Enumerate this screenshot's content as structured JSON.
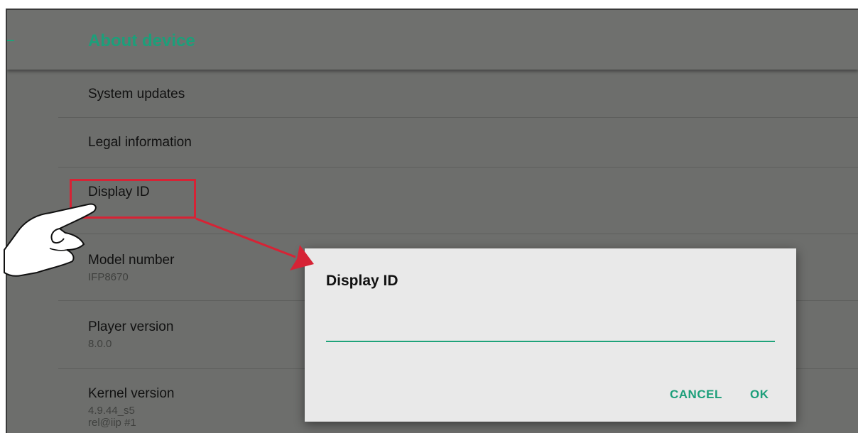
{
  "appbar": {
    "title": "About device"
  },
  "list": {
    "items": [
      {
        "title": "System updates",
        "subtitle": ""
      },
      {
        "title": "Legal information",
        "subtitle": ""
      },
      {
        "title": "Display ID",
        "subtitle": ""
      },
      {
        "title": "Model number",
        "subtitle": "IFP8670"
      },
      {
        "title": "Player version",
        "subtitle": "8.0.0"
      },
      {
        "title": "Kernel version",
        "subtitle": "4.9.44_s5",
        "subtitle2": "rel@iip #1"
      }
    ]
  },
  "dialog": {
    "title": "Display ID",
    "input_value": "",
    "cancel_label": "CANCEL",
    "ok_label": "OK"
  },
  "colors": {
    "accent": "#1c9f7a",
    "highlight": "#d62335",
    "screen_bg": "#6d6e6c",
    "dialog_bg": "#e9e9e9"
  },
  "icons": [
    "pointing-hand-icon",
    "callout-arrow-icon"
  ]
}
